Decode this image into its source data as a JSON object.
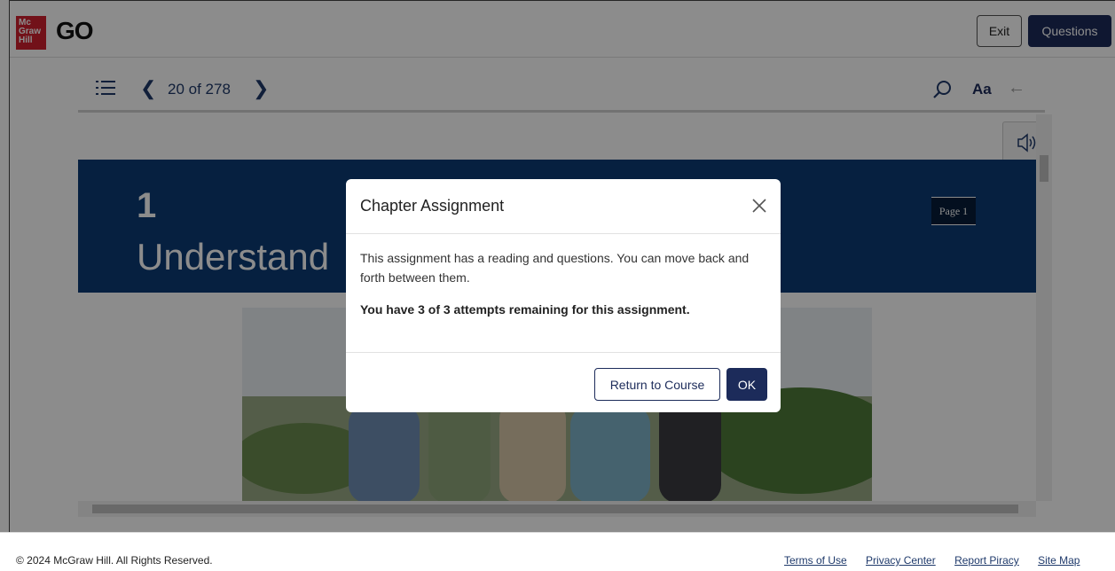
{
  "header": {
    "logo_text": "Mc Graw Hill",
    "app_name": "GO",
    "exit_label": "Exit",
    "questions_label": "Questions"
  },
  "reader": {
    "page_counter": "20 of 278",
    "font_size_label": "Aa",
    "chapter_number": "1",
    "chapter_title": "Understand",
    "page_label": "Page 1"
  },
  "modal": {
    "title": "Chapter Assignment",
    "body_text": "This assignment has a reading and questions. You can move back and forth between them.",
    "attempts_text": "You have 3 of 3 attempts remaining for this assignment.",
    "return_label": "Return to Course",
    "ok_label": "OK"
  },
  "footer": {
    "copyright": "© 2024 McGraw Hill. All Rights Reserved.",
    "links": [
      "Terms of Use",
      "Privacy Center",
      "Report Piracy",
      "Site Map"
    ]
  },
  "colors": {
    "brand_red": "#d0202e",
    "navy": "#1c2b5a",
    "banner_blue": "#0c3b75"
  }
}
